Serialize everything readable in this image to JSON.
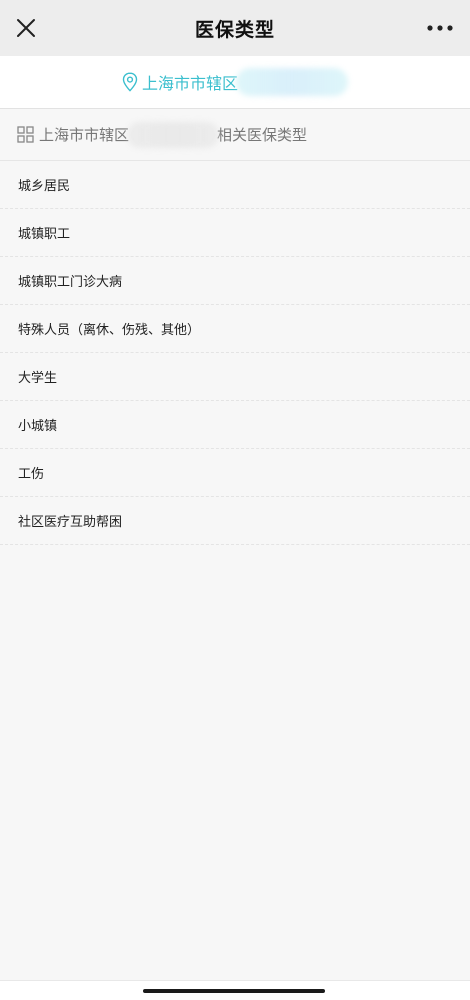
{
  "navbar": {
    "title": "医保类型",
    "close_icon": "close-icon",
    "more_icon": "more-icon"
  },
  "location": {
    "icon": "location-pin-icon",
    "text": "上海市市辖区"
  },
  "section": {
    "icon": "grid-icon",
    "prefix": "上海市市辖区",
    "suffix": "相关医保类型"
  },
  "insurance_types": [
    "城乡居民",
    "城镇职工",
    "城镇职工门诊大病",
    "特殊人员（离休、伤残、其他）",
    "大学生",
    "小城镇",
    "工伤",
    "社区医疗互助帮困"
  ],
  "colors": {
    "accent": "#3bbfce",
    "navbar_bg": "#ededed",
    "page_bg": "#f7f7f7"
  }
}
